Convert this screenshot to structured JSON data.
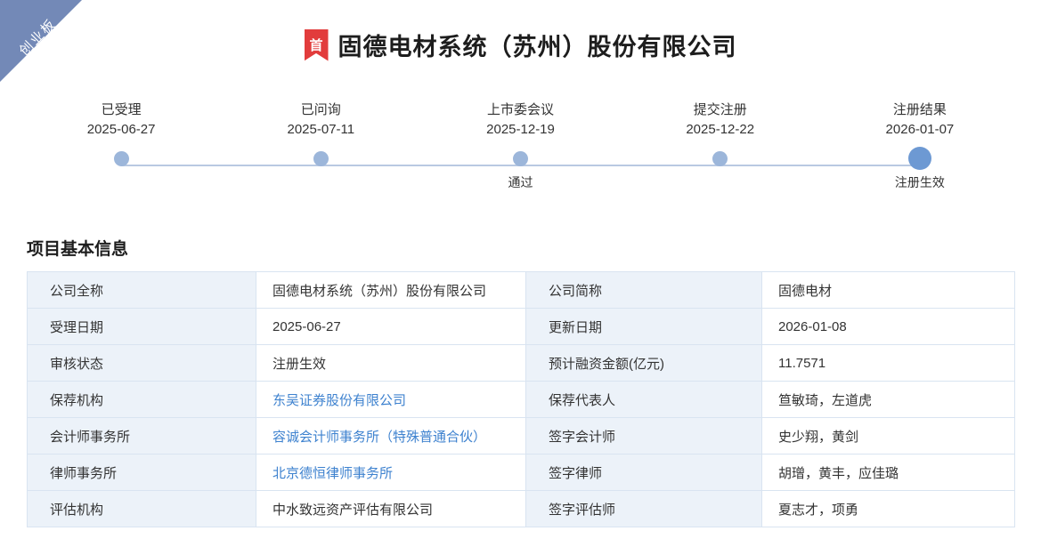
{
  "ribbon": {
    "label": "创业板"
  },
  "header": {
    "badge": "首",
    "title": "固德电材系统（苏州）股份有限公司"
  },
  "timeline": {
    "steps": [
      {
        "name": "已受理",
        "date": "2025-06-27",
        "sub": ""
      },
      {
        "name": "已问询",
        "date": "2025-07-11",
        "sub": ""
      },
      {
        "name": "上市委会议",
        "date": "2025-12-19",
        "sub": "通过"
      },
      {
        "name": "提交注册",
        "date": "2025-12-22",
        "sub": ""
      },
      {
        "name": "注册结果",
        "date": "2026-01-07",
        "sub": "注册生效"
      }
    ]
  },
  "section": {
    "title": "项目基本信息"
  },
  "table": {
    "rows": [
      {
        "label1": "公司全称",
        "value1": "固德电材系统（苏州）股份有限公司",
        "label2": "公司简称",
        "value2": "固德电材"
      },
      {
        "label1": "受理日期",
        "value1": "2025-06-27",
        "label2": "更新日期",
        "value2": "2026-01-08"
      },
      {
        "label1": "审核状态",
        "value1": "注册生效",
        "label2": "预计融资金额(亿元)",
        "value2": "11.7571"
      },
      {
        "label1": "保荐机构",
        "value1": "东吴证券股份有限公司",
        "label2": "保荐代表人",
        "value2": "笪敏琦，左道虎"
      },
      {
        "label1": "会计师事务所",
        "value1": "容诚会计师事务所（特殊普通合伙）",
        "label2": "签字会计师",
        "value2": "史少翔，黄剑"
      },
      {
        "label1": "律师事务所",
        "value1": "北京德恒律师事务所",
        "label2": "签字律师",
        "value2": "胡璔，黄丰，应佳璐"
      },
      {
        "label1": "评估机构",
        "value1": "中水致远资产评估有限公司",
        "label2": "签字评估师",
        "value2": "夏志才，项勇"
      }
    ]
  },
  "colors": {
    "ribbon": "#7389b7",
    "badge_red": "#e23c3c",
    "timeline_dot": "#9cb6da",
    "timeline_dot_active": "#6d99d3",
    "timeline_line": "#b9c9e2",
    "label_cell_bg": "#ecf2f9",
    "table_border": "#d9e4f1",
    "link_blue": "#3e82cf"
  }
}
